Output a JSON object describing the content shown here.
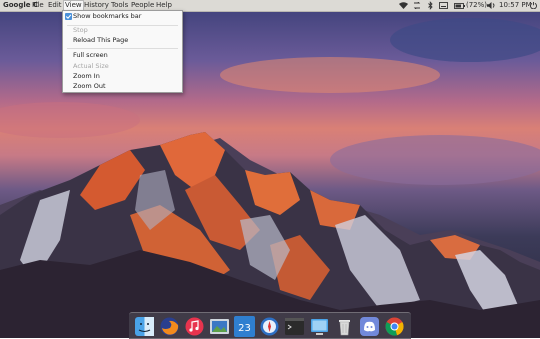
{
  "menubar": {
    "app_name": "Google C",
    "items": [
      "File",
      "Edit",
      "View",
      "History",
      "Tools",
      "People",
      "Help"
    ],
    "active_item": "View"
  },
  "tray": {
    "battery_text": "(72%)",
    "time": "10:57 PM"
  },
  "view_menu": {
    "show_bookmarks_bar": "Show bookmarks bar",
    "show_bookmarks_bar_checked": true,
    "stop": "Stop",
    "reload": "Reload This Page",
    "full_screen": "Full screen",
    "actual_size": "Actual Size",
    "zoom_in": "Zoom In",
    "zoom_out": "Zoom Out"
  },
  "dock": {
    "calendar_day": "23",
    "icons": [
      "finder-icon",
      "firefox-icon",
      "itunes-icon",
      "image-viewer-icon",
      "calendar-icon",
      "safari-icon",
      "terminal-icon",
      "files-icon",
      "trash-icon",
      "discord-icon",
      "chrome-icon"
    ]
  },
  "colors": {
    "menubar_bg": "#dcdad5",
    "check_accent": "#4a90d9",
    "dock_bg": "#46424e"
  }
}
